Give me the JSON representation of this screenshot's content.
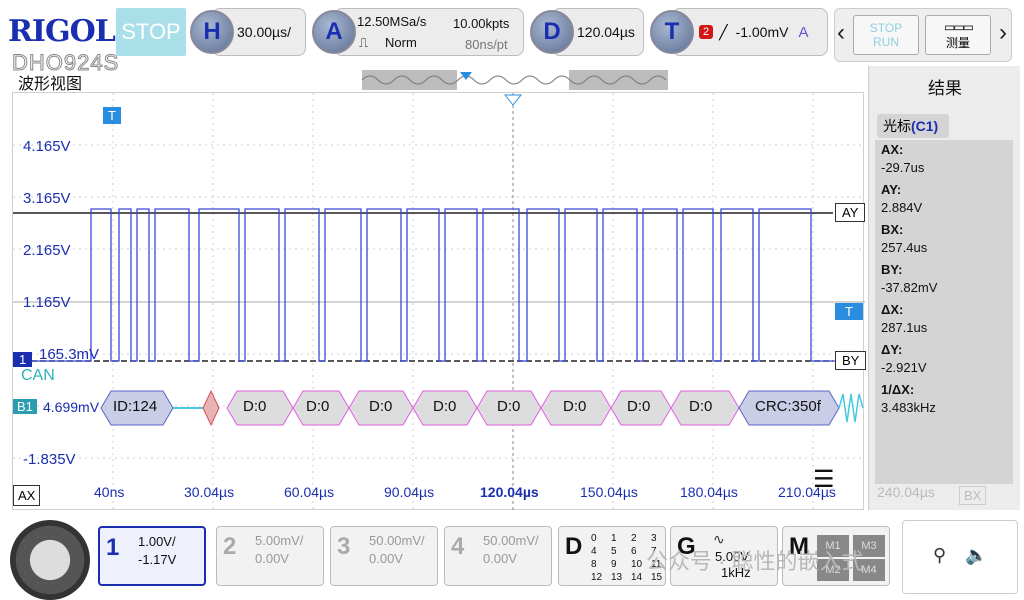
{
  "brand": {
    "logo": "RIGOL",
    "model": "DHO924S"
  },
  "top": {
    "stop_label": "STOP",
    "h_letter": "H",
    "h_value": "30.00µs/",
    "a_letter": "A",
    "sample_rate": "12.50MSa/s",
    "acq_mode": "Norm",
    "points": "10.00kpts",
    "time_per_pt": "80ns/pt",
    "d_letter": "D",
    "d_value": "120.04µs",
    "t_letter": "T",
    "trig_channel": "2",
    "trig_level": "-1.00mV",
    "trig_mode": "A",
    "stoprun_label_top": "STOP",
    "stoprun_label_bot": "RUN",
    "measure_label": "测量"
  },
  "window": {
    "title": "波形视图"
  },
  "y_labels": [
    "4.165V",
    "3.165V",
    "2.165V",
    "1.165V",
    "165.3mV",
    "-1.835V"
  ],
  "x_labels": [
    "40ns",
    "30.04µs",
    "60.04µs",
    "90.04µs",
    "120.04µs",
    "150.04µs",
    "180.04µs",
    "210.04µs",
    "240.04µs"
  ],
  "markers": {
    "ch1": "1",
    "can": "CAN",
    "b1": "B1",
    "b1_value": "4.699mV",
    "t": "T",
    "ay": "AY",
    "by": "BY",
    "ax": "AX",
    "bx": "BX"
  },
  "decode": [
    "ID:124",
    "D:0",
    "D:0",
    "D:0",
    "D:0",
    "D:0",
    "D:0",
    "D:0",
    "D:0",
    "CRC:350f"
  ],
  "results": {
    "title": "结果",
    "tab": "光标",
    "tab_ch": "(C1)",
    "rows": [
      {
        "k": "AX:",
        "v": "-29.7us"
      },
      {
        "k": "AY:",
        "v": "2.884V"
      },
      {
        "k": "BX:",
        "v": "257.4us"
      },
      {
        "k": "BY:",
        "v": "-37.82mV"
      },
      {
        "k": "ΔX:",
        "v": "287.1us"
      },
      {
        "k": "ΔY:",
        "v": "-2.921V"
      },
      {
        "k": "1/ΔX:",
        "v": "3.483kHz"
      }
    ]
  },
  "channels": [
    {
      "num": "1",
      "scale": "1.00V/",
      "offset": "-1.17V"
    },
    {
      "num": "2",
      "scale": "5.00mV/",
      "offset": "0.00V"
    },
    {
      "num": "3",
      "scale": "50.00mV/",
      "offset": "0.00V"
    },
    {
      "num": "4",
      "scale": "50.00mV/",
      "offset": "0.00V"
    }
  ],
  "digital": {
    "letter": "D",
    "nums": [
      "0",
      "1",
      "2",
      "3",
      "4",
      "5",
      "6",
      "7",
      "8",
      "9",
      "10",
      "11",
      "12",
      "13",
      "14",
      "15"
    ]
  },
  "gen": {
    "letter": "G",
    "value": "5.00V",
    "freq": "1kHz"
  },
  "math": {
    "letter": "M",
    "items": [
      "M1",
      "M3",
      "M2",
      "M4"
    ]
  },
  "watermark": "公众号 · 聪性的嵌入式"
}
